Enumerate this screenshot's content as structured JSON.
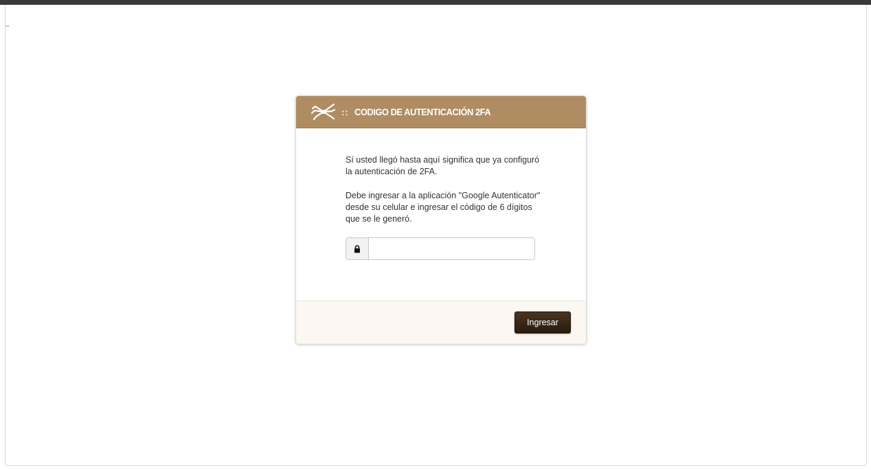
{
  "window": {
    "colors": {
      "top_bar": "#3a3a3a",
      "background": "#ffffff"
    }
  },
  "panel": {
    "header": {
      "logo_icon": "spider-logo-icon",
      "separator": "::",
      "title": "CODIGO DE AUTENTICACIÓN 2FA",
      "background_color": "#b08c63"
    },
    "body": {
      "paragraph_1": "Sí usted llegó hasta aquí significa que ya configuró la autenticación de 2FA.",
      "paragraph_2": "Debe ingresar a la aplicación \"Google Autenticator\" desde su celular e ingresar el código de 6 dígitos que se le generó.",
      "code_input": {
        "icon": "lock-icon",
        "value": "",
        "placeholder": ""
      }
    },
    "footer": {
      "submit_label": "Ingresar",
      "background_color": "#fcf7f0",
      "button_color": "#3a2816"
    }
  }
}
